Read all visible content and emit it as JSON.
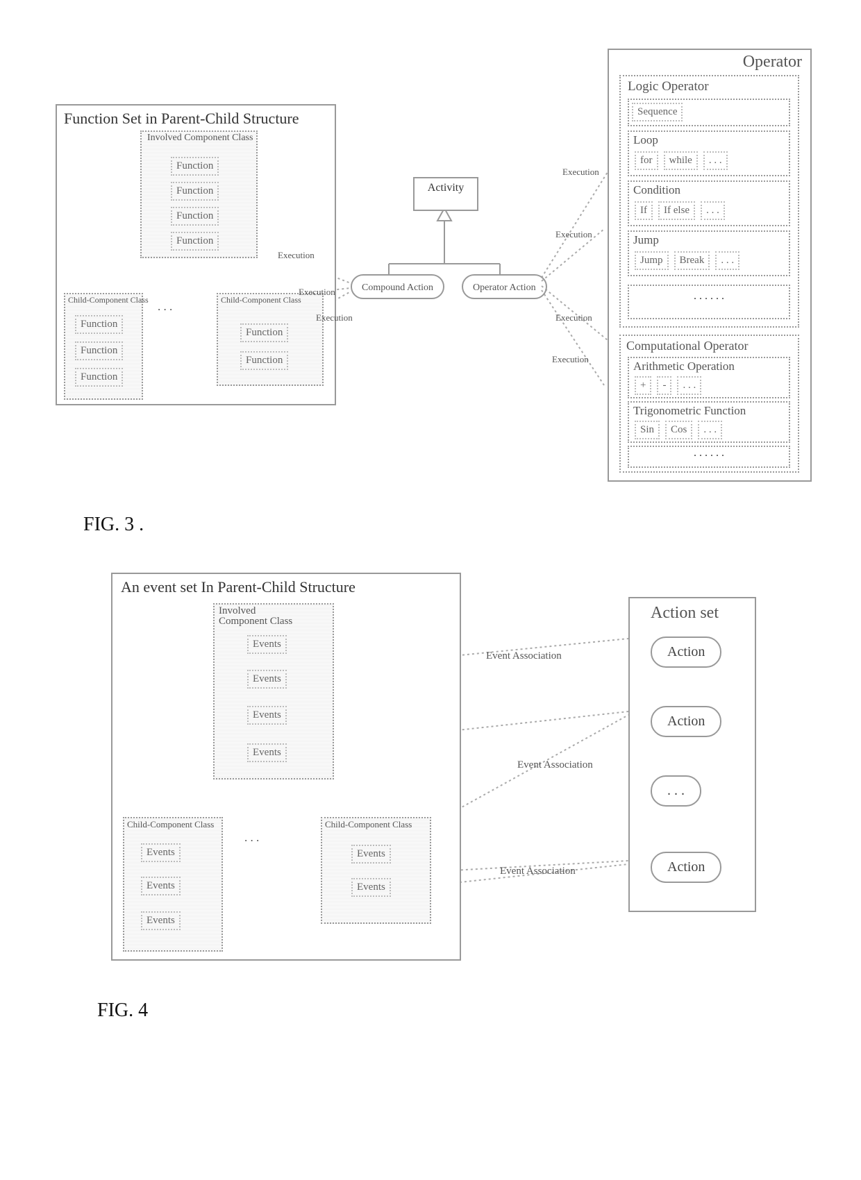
{
  "fig3": {
    "caption": "FIG. 3 .",
    "left_title": "Function Set in Parent-Child Structure",
    "involved": "Involved Component Class",
    "function": "Function",
    "child": "Child-Component Class",
    "activity": "Activity",
    "compound": "Compound Action",
    "opaction": "Operator Action",
    "exec": "Execution",
    "operator": "Operator",
    "logic": "Logic Operator",
    "sequence": "Sequence",
    "loop": "Loop",
    "for": "for",
    "while": "while",
    "condition": "Condition",
    "if": "If",
    "ifelse": "If else",
    "jump_title": "Jump",
    "jump": "Jump",
    "break": "Break",
    "comp_op": "Computational Operator",
    "arith": "Arithmetic Operation",
    "plus": "+",
    "minus": "-",
    "trig": "Trigonometric Function",
    "sin": "Sin",
    "cos": "Cos",
    "dots": ". . .",
    "dots6": ". . . . . ."
  },
  "fig4": {
    "caption": "FIG. 4",
    "title": "An event set In Parent-Child Structure",
    "involved": "Involved Component Class",
    "events": "Events",
    "child": "Child-Component Class",
    "assoc": "Event Association",
    "actionset": "Action set",
    "action": "Action",
    "dots": ". . ."
  }
}
